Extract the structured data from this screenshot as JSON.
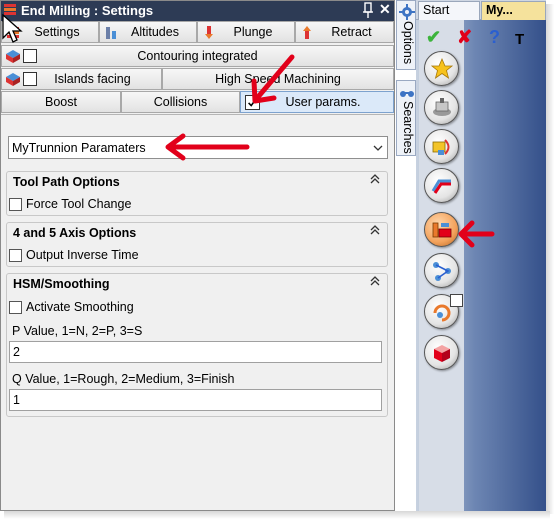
{
  "window": {
    "title": "End Milling : Settings",
    "close_glyph": "✕"
  },
  "tabs_row1": [
    "Settings",
    "Altitudes",
    "Plunge",
    "Retract"
  ],
  "tabs_row2": {
    "label": "Contouring integrated",
    "checked": false
  },
  "tabs_row3": [
    {
      "label": "Islands facing",
      "checked": false
    },
    {
      "label": "High Speed Machining"
    }
  ],
  "tabs_row4": [
    {
      "label": "Boost"
    },
    {
      "label": "Collisions"
    },
    {
      "label": "User params.",
      "checked": true,
      "active": true
    }
  ],
  "dropdown": {
    "value": "MyTrunnion Paramaters"
  },
  "groups": {
    "toolpath": {
      "title": "Tool Path Options",
      "checkbox_label": "Force Tool Change",
      "checked": false
    },
    "axis": {
      "title": "4 and 5 Axis Options",
      "checkbox_label": "Output Inverse Time",
      "checked": false
    },
    "hsm": {
      "title": "HSM/Smoothing",
      "checkbox_label": "Activate Smoothing",
      "checked": false,
      "p_label": "P Value, 1=N, 2=P, 3=S",
      "p_value": "2",
      "q_label": "Q Value, 1=Rough, 2=Medium, 3=Finish",
      "q_value": "1"
    }
  },
  "side_tabs": [
    "Options",
    "Searches"
  ],
  "doc_tabs": [
    "Start Page",
    "My..."
  ],
  "toolbar": {
    "top_icons": [
      "accept-check-icon",
      "cancel-x-icon",
      "help-question-icon",
      "text-t-icon"
    ],
    "top_glyphs": [
      "✔",
      "✘",
      "?",
      "T"
    ],
    "buttons": [
      "favorite-star-icon",
      "tool-icon",
      "geometry-icon",
      "contour-path-icon",
      "machining-params-icon",
      "axis-links-icon",
      "process-icon",
      "stock-box-icon"
    ]
  },
  "colors": {
    "titlebar": "#2d3b55",
    "accent_red": "#e2001a",
    "toolbar_blue": "#34508a"
  }
}
